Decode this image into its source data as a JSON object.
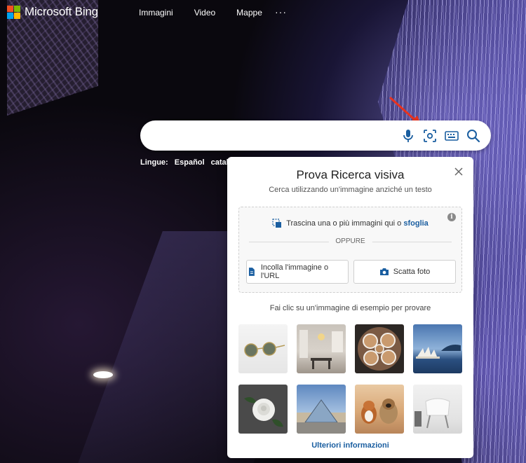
{
  "brand": {
    "name": "Microsoft Bing",
    "colors": [
      "#f25022",
      "#7fba00",
      "#00a4ef",
      "#ffb900"
    ]
  },
  "nav": {
    "items": [
      "Immagini",
      "Video",
      "Mappe"
    ],
    "more": "···"
  },
  "search": {
    "value": "",
    "icons": [
      "microphone-icon",
      "visual-search-icon",
      "keyboard-icon",
      "search-icon"
    ]
  },
  "languages": {
    "label": "Lingue:",
    "items": [
      "Español",
      "català"
    ]
  },
  "visual_search": {
    "title": "Prova Ricerca visiva",
    "subtitle": "Cerca utilizzando un'immagine anziché un testo",
    "drag_text": "Trascina una o più immagini qui o",
    "browse_link": "sfoglia",
    "or": "OPPURE",
    "paste_button": "Incolla l'immagine o l'URL",
    "photo_button": "Scatta foto",
    "examples_label": "Fai clic su un'immagine di esempio per provare",
    "examples": [
      "sunglasses",
      "dining-room",
      "coffee-cups",
      "sydney-opera-house",
      "white-rose",
      "louvre-pyramid",
      "dogs",
      "white-chair"
    ],
    "more_info": "Ulteriori informazioni",
    "accent": "#1a5ea0"
  }
}
